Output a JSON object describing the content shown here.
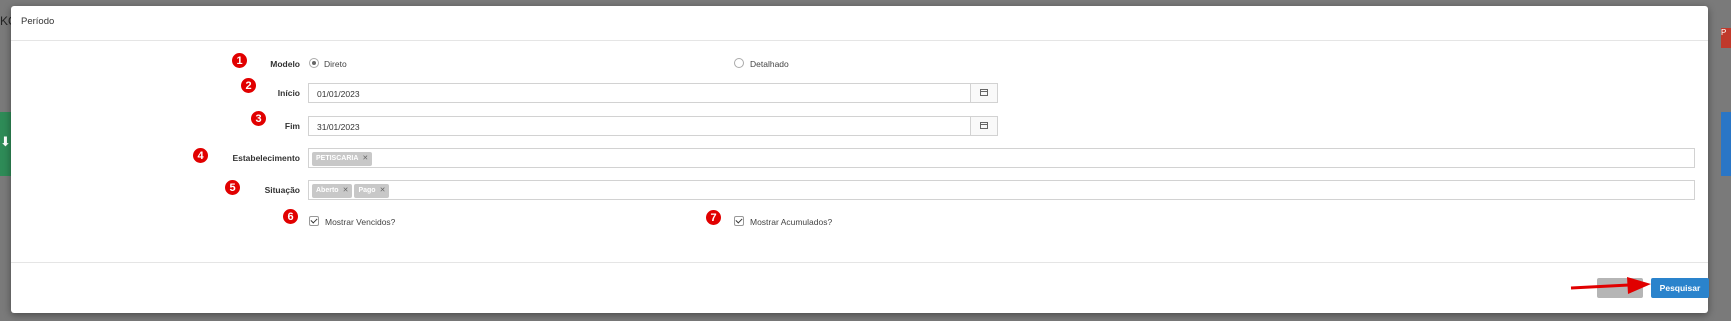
{
  "background": {
    "partial_text": "KO",
    "side_text": "P"
  },
  "modal": {
    "title": "Período"
  },
  "form": {
    "modelo": {
      "label": "Modelo",
      "options": [
        {
          "label": "Direto",
          "checked": true
        },
        {
          "label": "Detalhado",
          "checked": false
        }
      ]
    },
    "inicio": {
      "label": "Início",
      "value": "01/01/2023"
    },
    "fim": {
      "label": "Fim",
      "value": "31/01/2023"
    },
    "estabelecimento": {
      "label": "Estabelecimento",
      "tags": [
        "PETISCARIA"
      ]
    },
    "situacao": {
      "label": "Situação",
      "tags": [
        "Aberto",
        "Pago"
      ]
    },
    "mostrar_vencidos": {
      "label": "Mostrar Vencidos?",
      "checked": true
    },
    "mostrar_acumulados": {
      "label": "Mostrar Acumulados?",
      "checked": true
    }
  },
  "annotations": [
    "1",
    "2",
    "3",
    "4",
    "5",
    "6",
    "7"
  ],
  "footer": {
    "search_label": "Pesquisar"
  },
  "colors": {
    "accent": "#2a83cc",
    "annotation": "#e10000",
    "arrow": "#e10000"
  },
  "icons": [
    "calendar-icon",
    "remove-tag-icon",
    "arrow-annotation"
  ]
}
